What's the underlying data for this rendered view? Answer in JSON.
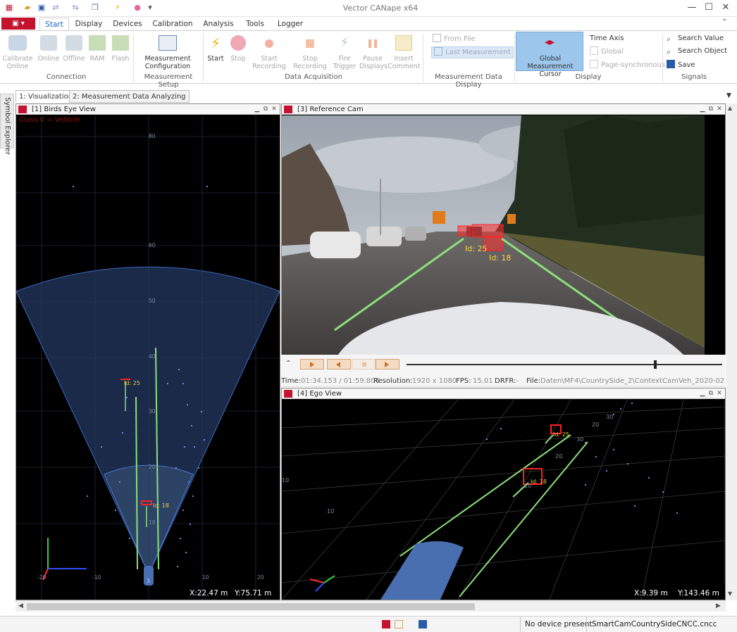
{
  "app": {
    "title": "Vector CANape x64"
  },
  "ribbon_tabs": [
    "Start",
    "Display",
    "Devices",
    "Calibration",
    "Analysis",
    "Tools",
    "Logger"
  ],
  "ribbon": {
    "connection": {
      "label": "Connection",
      "calibrate_online": "Calibrate\nOnline",
      "online": "Online",
      "offline": "Offline",
      "ram": "RAM",
      "flash": "Flash"
    },
    "setup": {
      "label": "Measurement Setup",
      "config": "Measurement\nConfiguration"
    },
    "acq": {
      "label": "Data Acquisition",
      "start": "Start",
      "stop": "Stop",
      "start_rec": "Start\nRecording",
      "stop_rec": "Stop\nRecording",
      "fire": "Fire\nTrigger",
      "pause": "Pause\nDisplays",
      "insert": "Insert\nComment"
    },
    "mdd": {
      "label": "Measurement Data Display",
      "from_file": "From File",
      "last_meas": "Last Measurement"
    },
    "display": {
      "label": "Display",
      "gmc": "Global Measurement\nCursor",
      "time_axis": "Time Axis",
      "global": "Global",
      "page_sync": "Page-synchronous"
    },
    "signals": {
      "label": "Signals",
      "search_value": "Search Value",
      "search_object": "Search Object",
      "save": "Save"
    }
  },
  "window_tabs": [
    "1: Visualization",
    "2: Measurement Data Analyzing"
  ],
  "side_tab": "Symbol Explorer",
  "panes": {
    "birds": {
      "title": "[1] Birds Eye View",
      "legend": "Class 0 = Vehicle",
      "x": "X:22.47 m",
      "y": "Y:75.71 m",
      "ids": [
        "Id: 25",
        "Id: 18"
      ],
      "y_ticks": [
        "80",
        "60",
        "50",
        "40",
        "30",
        "20",
        "10"
      ],
      "x_ticks": [
        "-20",
        "-10",
        "10",
        "20"
      ],
      "ego_label": "3"
    },
    "cam": {
      "title": "[3] Reference Cam",
      "ids": [
        "Id: 25",
        "Id: 18"
      ]
    },
    "ego": {
      "title": "[4] Ego View",
      "x": "X:9.39 m",
      "y": "Y:143.46 m",
      "ids": [
        "Id: 25",
        "Id: 18"
      ],
      "ticks": [
        "20",
        "30",
        "10",
        "10",
        "10",
        "20",
        "30"
      ]
    }
  },
  "playback": {
    "time_label": "Time:",
    "time": "01:34.153 / 01:59.806",
    "res_label": "Resolution:",
    "res": "1920 x 1080",
    "fps_label": "FPS:",
    "fps": "15.01",
    "drfr_label": "DRFR:",
    "drfr": "-",
    "file_label": "File:",
    "file": "Daten\\MF4\\CountrySide_2\\ContextCamVeh_2020-02-14..."
  },
  "status": {
    "device": "No device present",
    "config": "SmartCamCountrySideCNCC.cncc"
  }
}
